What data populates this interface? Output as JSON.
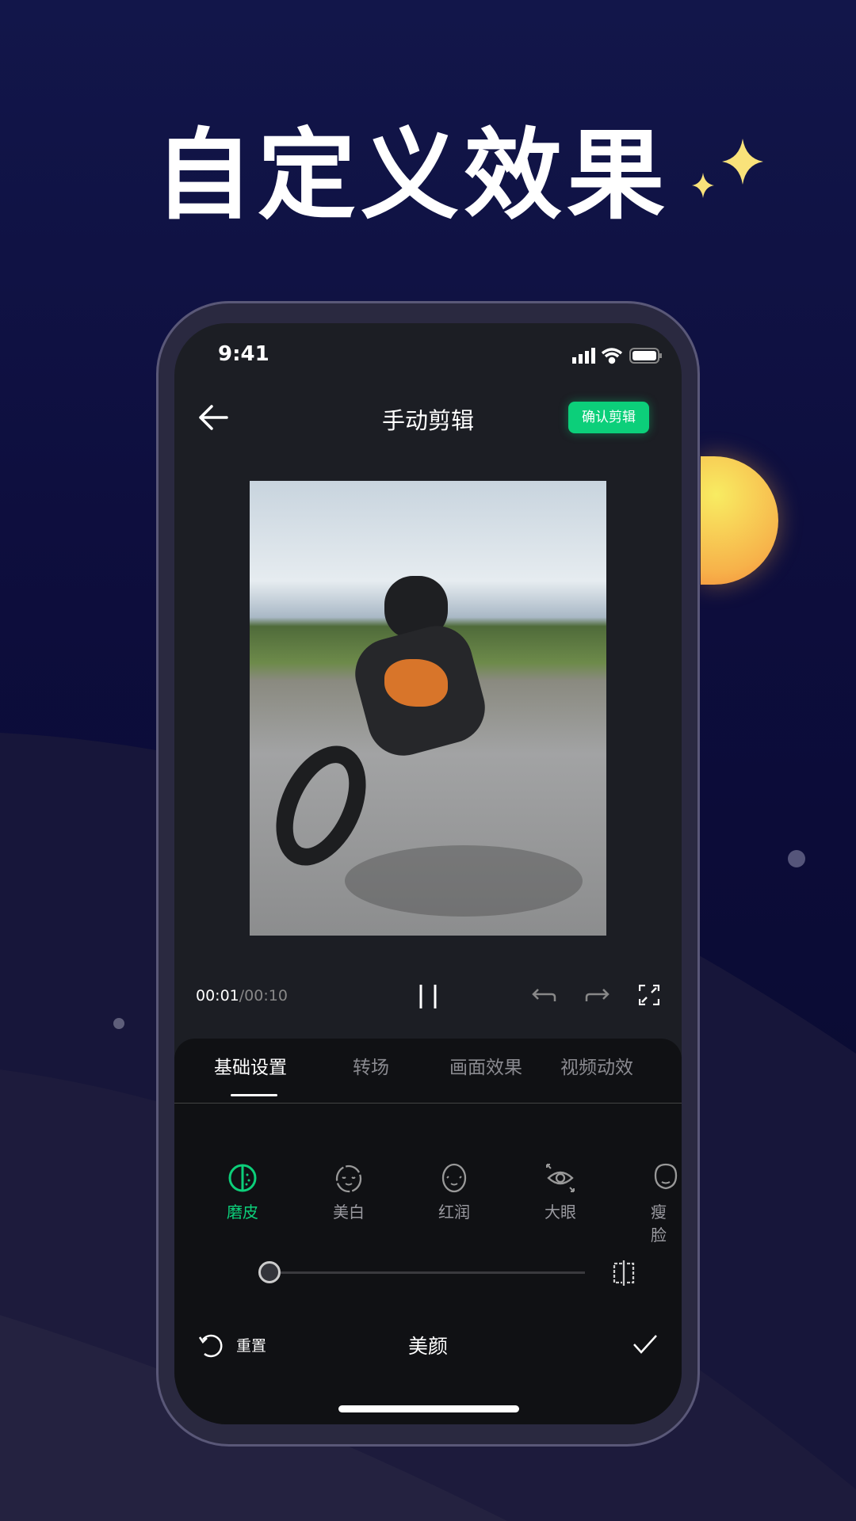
{
  "headline": "自定义效果",
  "colors": {
    "accent": "#0ccf7a",
    "moon": "#f7c84a",
    "background": "#0d0d3c"
  },
  "status_bar": {
    "time": "9:41",
    "icons": [
      "signal-icon",
      "wifi-icon",
      "battery-icon"
    ]
  },
  "header": {
    "title": "手动剪辑",
    "confirm_label": "确认剪辑",
    "back_icon": "arrow-left-icon"
  },
  "player": {
    "current_time": "00:01",
    "total_time": "/00:10",
    "icons": [
      "pause-icon",
      "undo-icon",
      "redo-icon",
      "fullscreen-icon"
    ]
  },
  "tabs": [
    {
      "label": "基础设置",
      "active": true
    },
    {
      "label": "转场"
    },
    {
      "label": "画面效果"
    },
    {
      "label": "视频动效"
    }
  ],
  "beauty_items": [
    {
      "label": "磨皮",
      "active": true
    },
    {
      "label": "美白"
    },
    {
      "label": "红润"
    },
    {
      "label": "大眼"
    },
    {
      "label": "瘦脸"
    }
  ],
  "slider": {
    "value": 0
  },
  "bottom_bar": {
    "reset_label": "重置",
    "title": "美颜"
  }
}
